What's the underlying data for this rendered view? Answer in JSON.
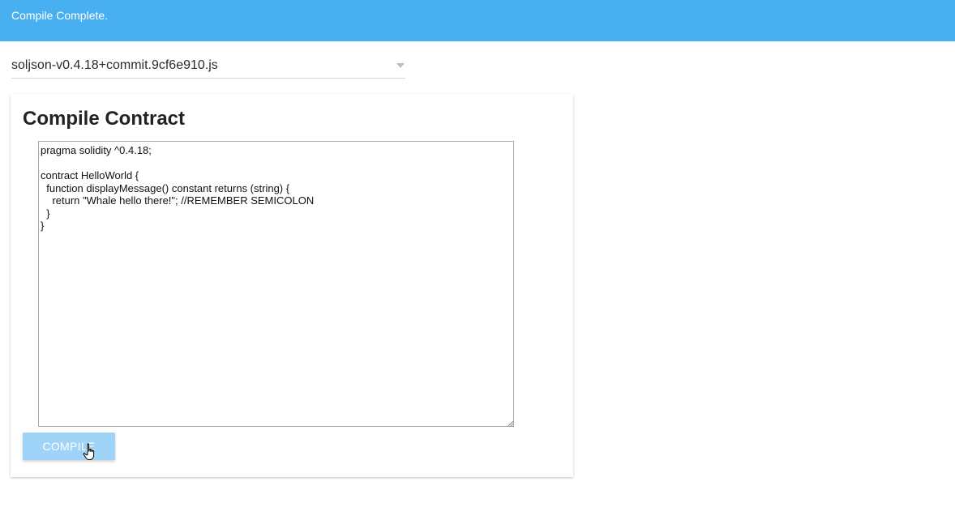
{
  "status_bar": {
    "message": "Compile Complete.",
    "color": "#48aff0"
  },
  "compiler_select": {
    "selected": "soljson-v0.4.18+commit.9cf6e910.js",
    "icon": "chevron-down-icon"
  },
  "compile_card": {
    "title": "Compile Contract",
    "source_code": "pragma solidity ^0.4.18;\n\ncontract HelloWorld {\n  function displayMessage() constant returns (string) {\n    return \"Whale hello there!\"; //REMEMBER SEMICOLON\n  }\n}",
    "compile_button_label": "COMPILE",
    "compile_button_color": "#9fd3f7"
  },
  "pointer": {
    "icon": "hand-pointer-icon"
  }
}
